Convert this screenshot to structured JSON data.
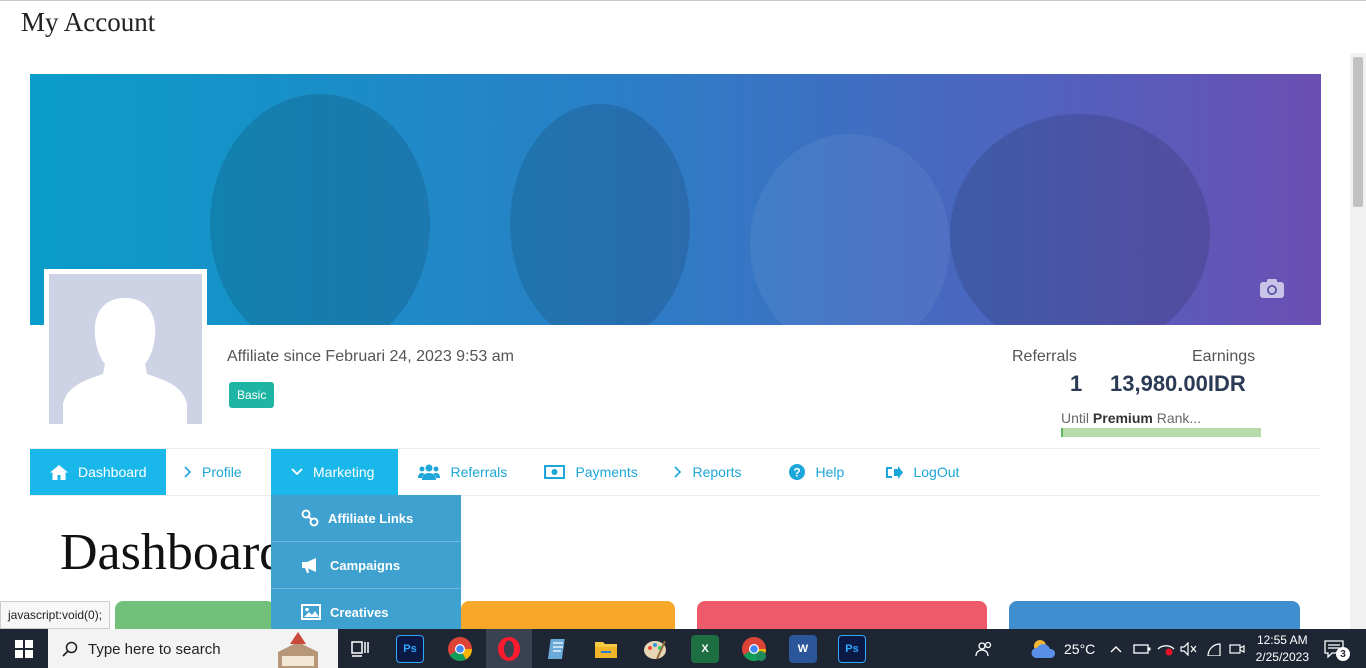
{
  "page_title": "My Account",
  "profile": {
    "since": "Affiliate since Februari 24, 2023 9:53 am",
    "rank_badge": "Basic",
    "referrals_label": "Referrals",
    "referrals_value": "1",
    "earnings_label": "Earnings",
    "earnings_value": "13,980.00IDR",
    "until_prefix": "Until ",
    "until_rank": "Premium",
    "until_suffix": " Rank...",
    "rank_progress": 0.01
  },
  "nav": {
    "dashboard": "Dashboard",
    "profile": "Profile",
    "marketing": "Marketing",
    "referrals": "Referrals",
    "payments": "Payments",
    "reports": "Reports",
    "help": "Help",
    "logout": "LogOut"
  },
  "marketing_menu": {
    "affiliate_links": "Affiliate Links",
    "campaigns": "Campaigns",
    "creatives": "Creatives"
  },
  "dashboard_heading": "Dashboard",
  "status_bar": "javascript:void(0);",
  "taskbar": {
    "search_placeholder": "Type here to search",
    "weather_temp": "25°C",
    "time": "12:55 AM",
    "date": "2/25/2023",
    "notification_count": "3"
  },
  "colors": {
    "accent": "#1ab8ea",
    "dropdown": "#3ea1cf",
    "badge": "#1fb5a4",
    "card_green": "#72c17a",
    "card_orange": "#f7a82a",
    "card_red": "#ef5a6b",
    "card_blue": "#3f8ed0"
  }
}
